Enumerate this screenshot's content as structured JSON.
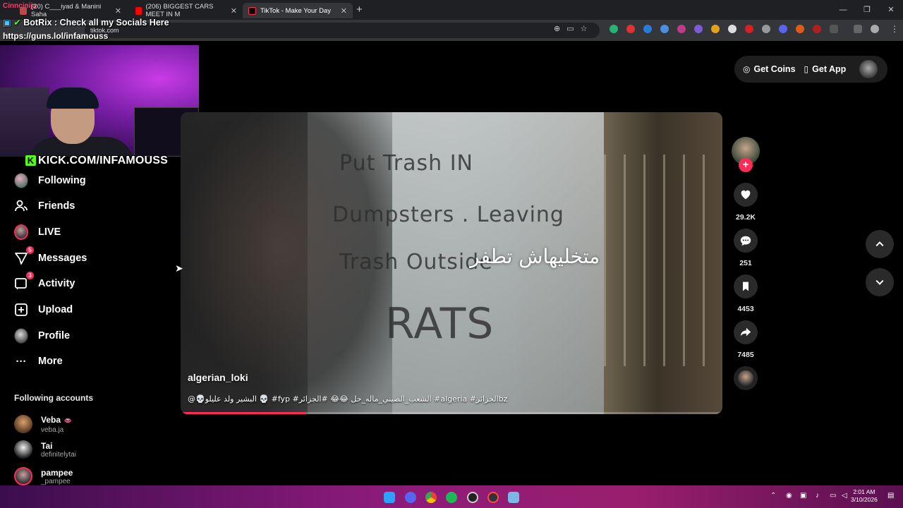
{
  "browser": {
    "streamer_tag": "Cinncinija",
    "tabs": [
      {
        "label": "(20) C___iyad & Manini Saha",
        "active": false
      },
      {
        "label": "(206) BIGGEST CARS MEET IN M",
        "active": false
      },
      {
        "label": "TikTok - Make Your Day",
        "active": true
      }
    ],
    "new_tab": "+",
    "url": "tiktok.com",
    "window_controls": [
      "—",
      "❐",
      "✕"
    ]
  },
  "stream_overlay": {
    "botrix_text": "BotRix : Check all my Socials Here",
    "guns_link": "https://guns.lol/infamouss",
    "kick_text": "KICK.COM/INFAMOUSS",
    "kick_logo_letter": "K"
  },
  "sidebar": {
    "items": [
      {
        "label": "Following",
        "icon": "following-avatar",
        "badge": ""
      },
      {
        "label": "Friends",
        "icon": "friends-icon",
        "badge": ""
      },
      {
        "label": "LIVE",
        "icon": "live-avatar",
        "badge": ""
      },
      {
        "label": "Messages",
        "icon": "messages-icon",
        "badge": "5"
      },
      {
        "label": "Activity",
        "icon": "activity-icon",
        "badge": "3"
      },
      {
        "label": "Upload",
        "icon": "upload-icon",
        "badge": ""
      },
      {
        "label": "Profile",
        "icon": "profile-avatar",
        "badge": ""
      },
      {
        "label": "More",
        "icon": "more-icon",
        "badge": ""
      }
    ],
    "following_title": "Following accounts",
    "following_accounts": [
      {
        "name": "Veba",
        "handle": "veba.ja",
        "emoji": "👄"
      },
      {
        "name": "Tai",
        "handle": "definitelytai",
        "emoji": ""
      },
      {
        "name": "pampee",
        "handle": "_pampee",
        "emoji": ""
      }
    ]
  },
  "header": {
    "get_coins": "Get Coins",
    "get_app": "Get App"
  },
  "video": {
    "overlay_text": "متخليهاش تطفر",
    "username": "algerian_loki",
    "caption": "@💀البشير ولد عليلو 💀 #fyp #الشعب_الصيني_ماله_حل 😂😂 #الجزائر #algeria #الجزائرbz",
    "progress": 0.23,
    "scribbles": [
      "Put Trash IN",
      "Dumpsters . Leaving",
      "Trash Outside",
      "RATS"
    ]
  },
  "actions": {
    "follow_plus": "+",
    "likes": "29.2K",
    "comments": "251",
    "saves": "4453",
    "shares": "7485"
  },
  "taskbar": {
    "time": "2:01 AM",
    "date": "3/10/2026"
  },
  "colors": {
    "accent": "#fe2c55",
    "kick_green": "#53fc18"
  }
}
